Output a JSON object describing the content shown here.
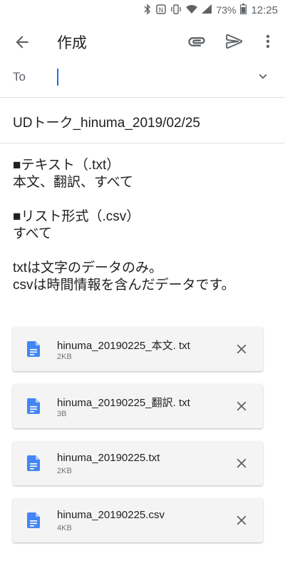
{
  "status_bar": {
    "battery_percent": "73%",
    "time": "12:25",
    "icons": [
      "bluetooth-icon",
      "nfc-icon",
      "vibrate-icon",
      "wifi-icon",
      "signal-icon",
      "battery-icon"
    ]
  },
  "app_bar": {
    "title": "作成",
    "icons": [
      "back-arrow-icon",
      "paperclip-icon",
      "send-icon",
      "more-vert-icon"
    ]
  },
  "to_field": {
    "label": "To",
    "value": ""
  },
  "subject": "UDトーク_hinuma_2019/02/25",
  "body": {
    "lines": [
      "■テキスト（.txt）",
      "本文、翻訳、すべて",
      "",
      "■リスト形式（.csv）",
      "すべて",
      "",
      "txtは文字のデータのみ。",
      "csvは時間情報を含んだデータです。"
    ]
  },
  "attachments": [
    {
      "name": "hinuma_20190225_本文. txt",
      "size": "2KB"
    },
    {
      "name": "hinuma_20190225_翻訳. txt",
      "size": "3B"
    },
    {
      "name": "hinuma_20190225.txt",
      "size": "2KB"
    },
    {
      "name": "hinuma_20190225.csv",
      "size": "4KB"
    }
  ],
  "colors": {
    "accent": "#1a73e8",
    "file_icon": "#4285f4",
    "icon_gray": "#5f6368"
  }
}
